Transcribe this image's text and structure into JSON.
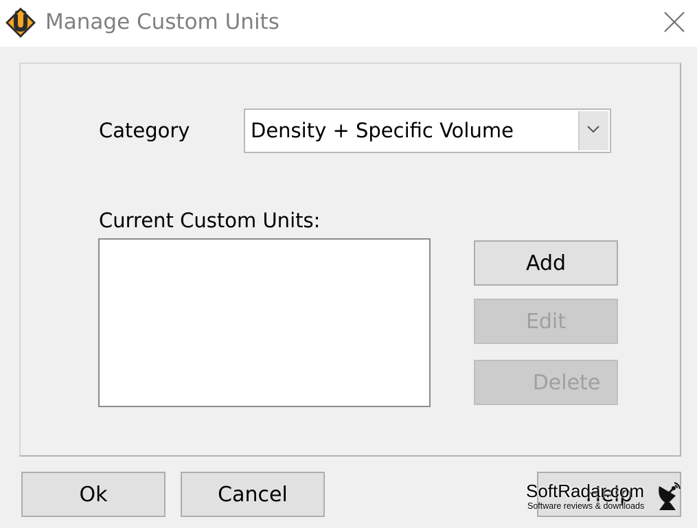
{
  "window": {
    "title": "Manage Custom Units",
    "icon": "app-logo-icon",
    "close_icon": "close-icon"
  },
  "form": {
    "category_label": "Category",
    "category_value": "Density + Specific Volume",
    "dropdown_icon": "chevron-down-icon",
    "custom_units_label": "Current Custom Units:",
    "custom_units_items": []
  },
  "actions": {
    "add_label": "Add",
    "edit_label": "Edit",
    "delete_label": "Delete"
  },
  "footer": {
    "ok_label": "Ok",
    "cancel_label": "Cancel",
    "help_label": "Help"
  },
  "watermark": {
    "title": "SoftRadar.com",
    "subtitle": "Software reviews & downloads",
    "icon": "satellite-dish-icon"
  },
  "colors": {
    "panel_bg": "#f0f0f0",
    "titlebar_bg": "#ffffff",
    "button_bg": "#e1e1e1",
    "disabled_button_bg": "#cccccc",
    "logo_orange": "#f5a623",
    "logo_dark": "#2b2b2b"
  }
}
